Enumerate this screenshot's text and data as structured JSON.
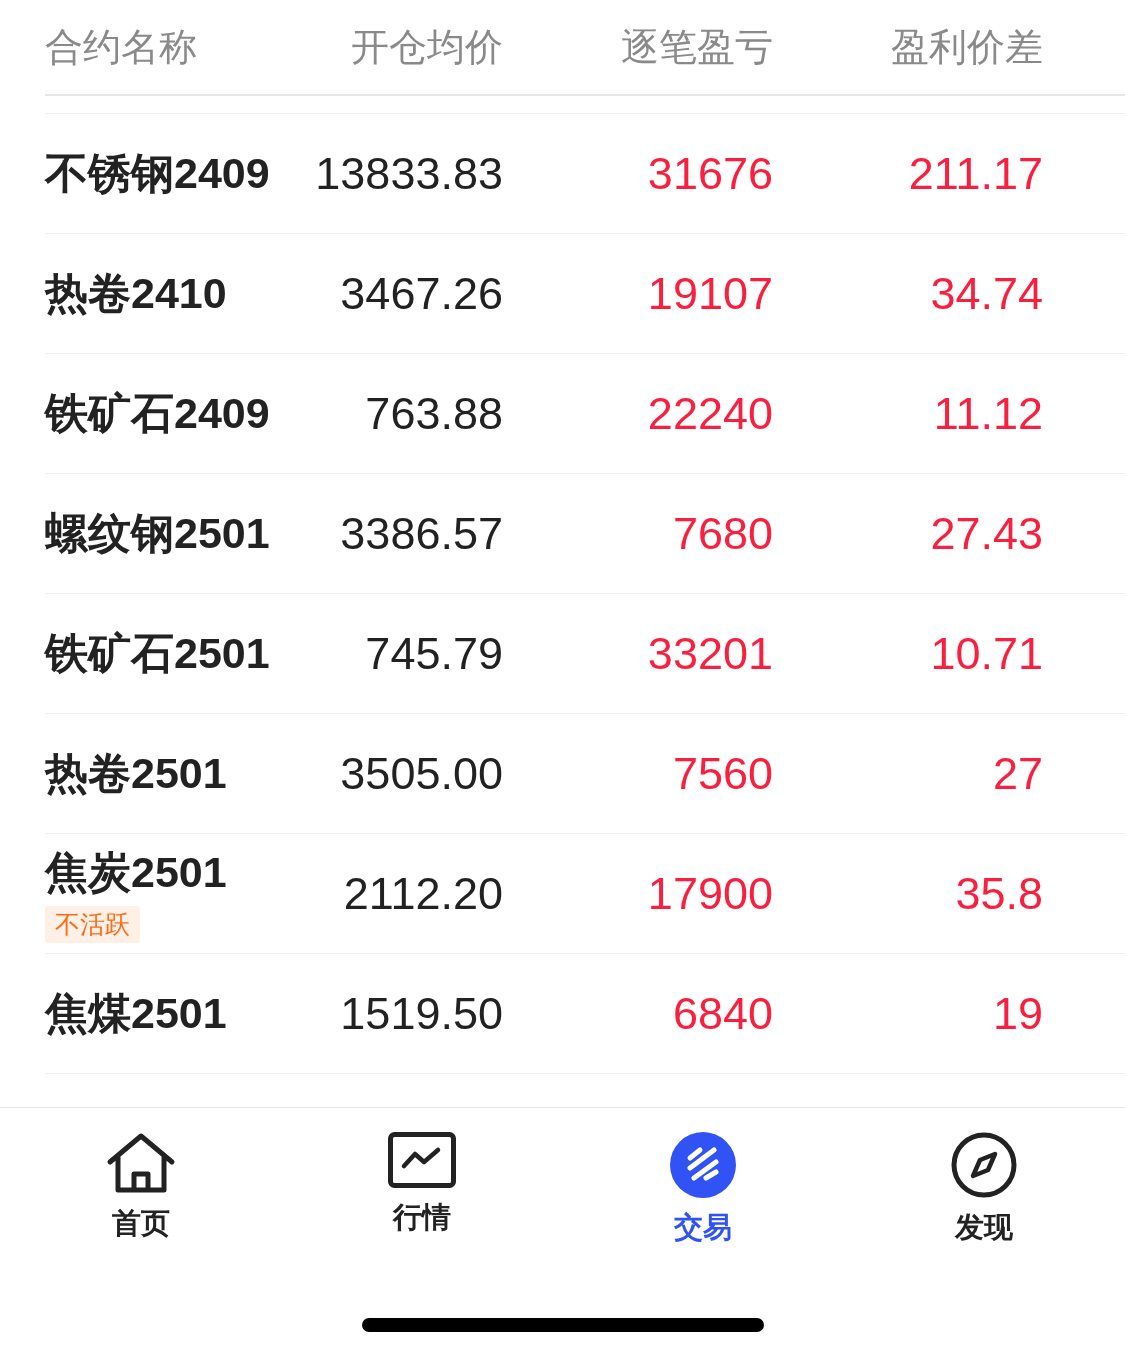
{
  "table": {
    "columns": [
      "合约名称",
      "开仓均价",
      "逐笔盈亏",
      "盈利价差"
    ],
    "rows": [
      {
        "name": "不锈钢2409",
        "avg_price": "13833.83",
        "pnl": "31676",
        "spread": "211.17"
      },
      {
        "name": "热卷2410",
        "avg_price": "3467.26",
        "pnl": "19107",
        "spread": "34.74"
      },
      {
        "name": "铁矿石2409",
        "avg_price": "763.88",
        "pnl": "22240",
        "spread": "11.12"
      },
      {
        "name": "螺纹钢2501",
        "avg_price": "3386.57",
        "pnl": "7680",
        "spread": "27.43"
      },
      {
        "name": "铁矿石2501",
        "avg_price": "745.79",
        "pnl": "33201",
        "spread": "10.71"
      },
      {
        "name": "热卷2501",
        "avg_price": "3505.00",
        "pnl": "7560",
        "spread": "27"
      },
      {
        "name": "焦炭2501",
        "tag": "不活跃",
        "avg_price": "2112.20",
        "pnl": "17900",
        "spread": "35.8"
      },
      {
        "name": "焦煤2501",
        "avg_price": "1519.50",
        "pnl": "6840",
        "spread": "19"
      }
    ]
  },
  "tab_bar": [
    {
      "label": "首页",
      "selected": false
    },
    {
      "label": "行情",
      "selected": false
    },
    {
      "label": "交易",
      "selected": true
    },
    {
      "label": "发现",
      "selected": false
    }
  ]
}
